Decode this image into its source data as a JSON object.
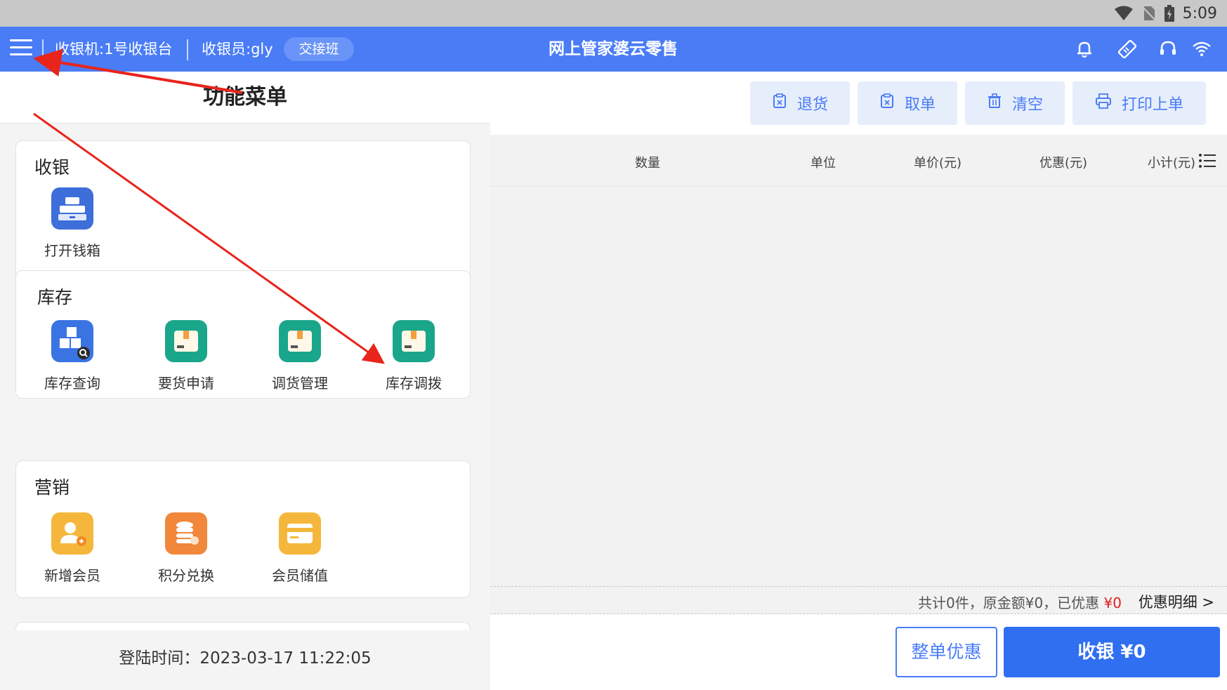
{
  "status_bar": {
    "time": "5:09"
  },
  "header": {
    "register": "收银机:1号收银台",
    "cashier": "收银员:gly",
    "shift_button": "交接班",
    "title": "网上管家婆云零售"
  },
  "menu_panel": {
    "title": "功能菜单",
    "sections": [
      {
        "title": "收银",
        "items": [
          {
            "label": "打开钱箱",
            "icon": "cash-register-icon"
          }
        ]
      },
      {
        "title": "库存",
        "items": [
          {
            "label": "库存查询",
            "icon": "inventory-search-icon"
          },
          {
            "label": "要货申请",
            "icon": "package-request-icon"
          },
          {
            "label": "调货管理",
            "icon": "package-transfer-icon"
          },
          {
            "label": "库存调拨",
            "icon": "package-allocate-icon"
          }
        ]
      },
      {
        "title": "营销",
        "items": [
          {
            "label": "新增会员",
            "icon": "add-member-icon"
          },
          {
            "label": "积分兑换",
            "icon": "points-exchange-icon"
          },
          {
            "label": "会员储值",
            "icon": "member-card-icon"
          }
        ]
      }
    ],
    "login_time": "登陆时间：2023-03-17 11:22:05"
  },
  "toolbar": {
    "return_label": "退货",
    "fetch_label": "取单",
    "clear_label": "清空",
    "print_label": "打印上单"
  },
  "table": {
    "columns": [
      "数量",
      "单位",
      "单价(元)",
      "优惠(元)",
      "小计(元)"
    ]
  },
  "summary": {
    "text": "共计0件，原金额¥0，已优惠",
    "discount": "¥0",
    "detail_link": "优惠明细 >"
  },
  "actions": {
    "whole_discount": "整单优惠",
    "checkout": "收银 ¥0"
  },
  "colors": {
    "primary": "#4a7cf6",
    "checkout": "#2f6ff0",
    "discount_red": "#e02020",
    "annotation": "#e8241b"
  }
}
